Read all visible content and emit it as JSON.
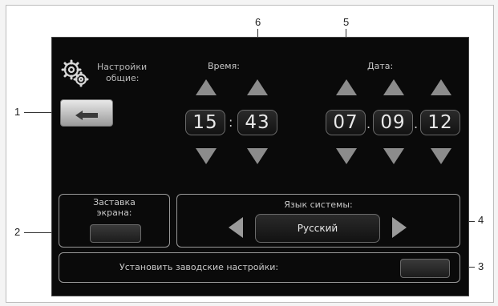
{
  "settings": {
    "title_line1": "Настройки",
    "title_line2": "общие:"
  },
  "time": {
    "label": "Время:",
    "hours": "15",
    "minutes": "43",
    "separator": ":"
  },
  "date": {
    "label": "Дата:",
    "day": "07",
    "month": "09",
    "year": "12",
    "separator": "."
  },
  "screensaver": {
    "label_line1": "Заставка",
    "label_line2": "экрана:"
  },
  "language": {
    "label": "Язык системы:",
    "value": "Русский"
  },
  "factory_reset": {
    "label": "Установить заводские настройки:"
  },
  "callouts": {
    "c1": "1",
    "c2": "2",
    "c3": "3",
    "c4": "4",
    "c5": "5",
    "c6": "6"
  },
  "colors": {
    "background": "#0a0a0a",
    "text": "#c8c8c8",
    "control": "#8c8c8c"
  }
}
